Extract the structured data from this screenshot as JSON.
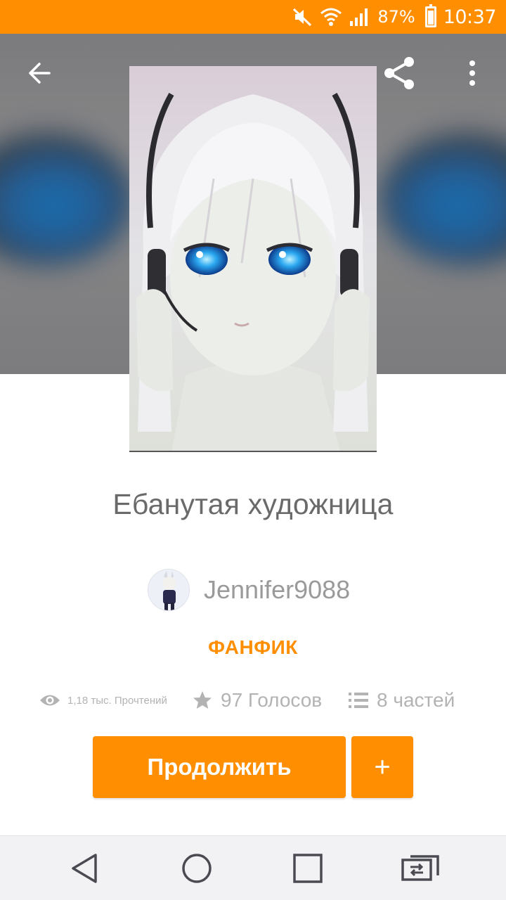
{
  "status_bar": {
    "battery_percent": "87%",
    "time": "10:37",
    "icons": [
      "mute-icon",
      "wifi-icon",
      "signal-icon",
      "battery-icon"
    ]
  },
  "toolbar": {
    "back_icon": "arrow-back-icon",
    "share_icon": "share-icon",
    "more_icon": "more-vertical-icon"
  },
  "story": {
    "title": "Ебанутая художница",
    "author": "Jennifer9088",
    "category": "ФАНФИК",
    "stats": {
      "reads": "1,18 тыс. Прочтений",
      "votes": "97 Голосов",
      "parts": "8 частей"
    }
  },
  "actions": {
    "continue_label": "Продолжить",
    "add_label": "+"
  },
  "colors": {
    "accent": "#ff8f00",
    "title_text": "#6a6a6a",
    "muted_text": "#b3b3b3"
  }
}
